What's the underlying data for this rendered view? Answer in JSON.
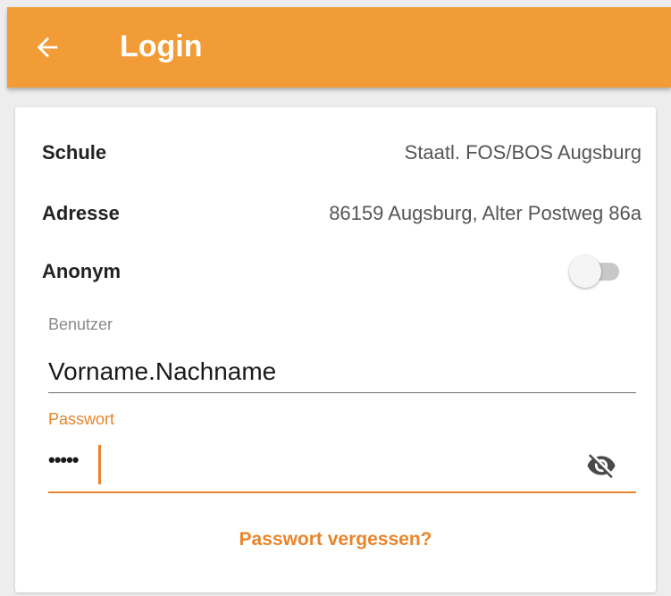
{
  "appbar": {
    "title": "Login"
  },
  "info": {
    "school_label": "Schule",
    "school_value": "Staatl. FOS/BOS Augsburg",
    "address_label": "Adresse",
    "address_value": "86159 Augsburg, Alter Postweg 86a",
    "anonymous_label": "Anonym",
    "anonymous_on": false
  },
  "form": {
    "user_label": "Benutzer",
    "user_value": "Vorname.Nachname",
    "password_label": "Passwort",
    "password_mask": "•••••",
    "forgot_label": "Passwort vergessen?"
  },
  "colors": {
    "appbar": "#f19c37",
    "accent": "#e8852c"
  },
  "icons": {
    "back": "arrow-left-icon",
    "password_visibility": "eye-off-icon"
  }
}
